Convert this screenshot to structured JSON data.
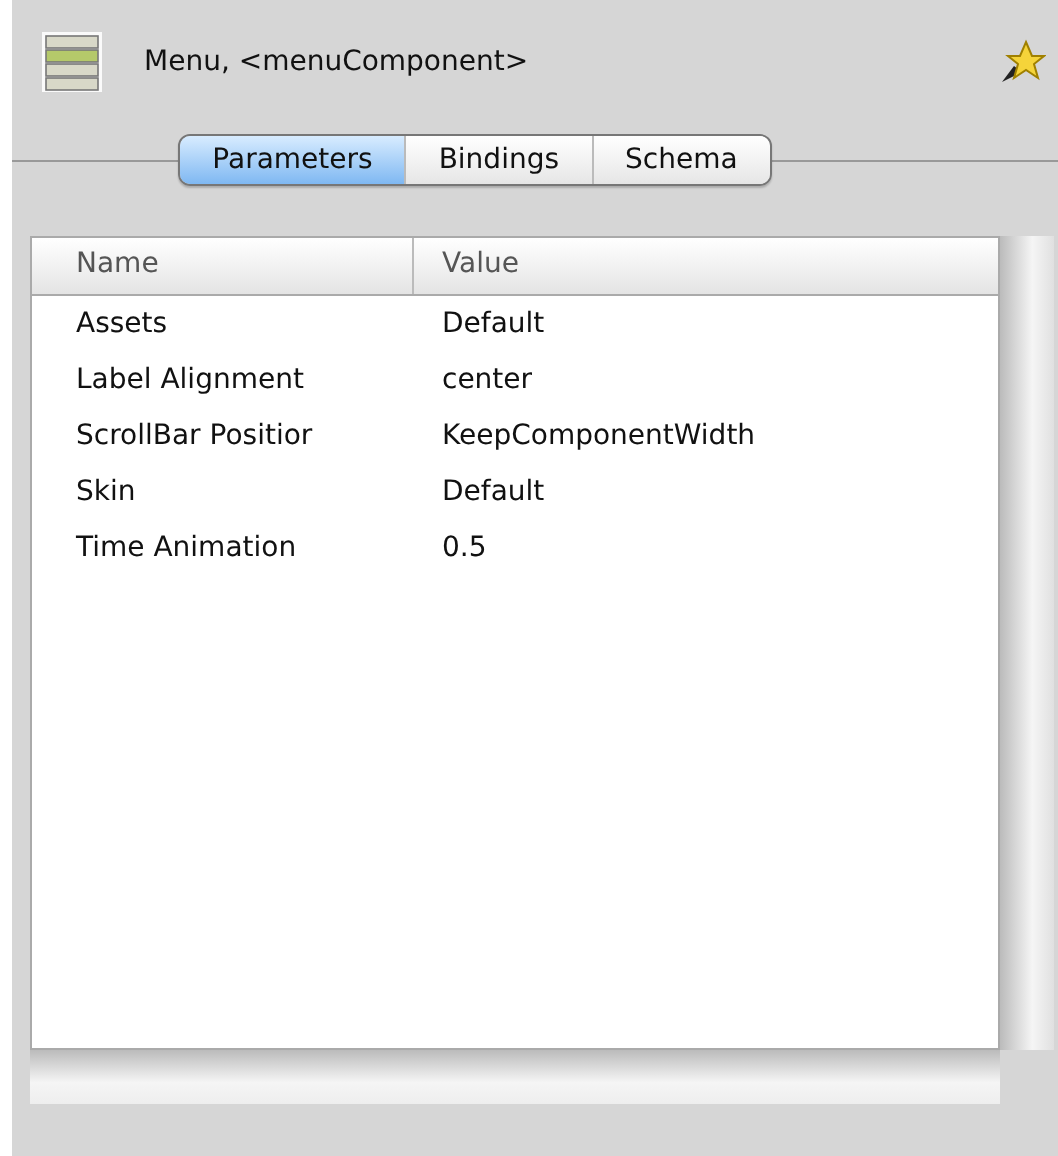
{
  "header": {
    "title": "Menu, <menuComponent>"
  },
  "tabs": [
    {
      "label": "Parameters",
      "selected": true
    },
    {
      "label": "Bindings",
      "selected": false
    },
    {
      "label": "Schema",
      "selected": false
    }
  ],
  "table": {
    "columns": [
      "Name",
      "Value"
    ],
    "rows": [
      {
        "name": "Assets",
        "value": "Default"
      },
      {
        "name": "Label Alignment",
        "value": "center"
      },
      {
        "name": "ScrollBar Positior",
        "value": "KeepComponentWidth"
      },
      {
        "name": "Skin",
        "value": "Default"
      },
      {
        "name": "Time Animation",
        "value": "0.5"
      }
    ]
  }
}
